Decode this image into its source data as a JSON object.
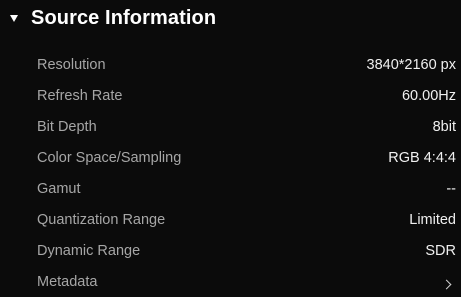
{
  "section": {
    "title": "Source Information",
    "expand_icon": "triangle-down-icon"
  },
  "rows": [
    {
      "label": "Resolution",
      "value": "3840*2160 px"
    },
    {
      "label": "Refresh Rate",
      "value": "60.00Hz"
    },
    {
      "label": "Bit Depth",
      "value": "8bit"
    },
    {
      "label": "Color Space/Sampling",
      "value": "RGB 4:4:4"
    },
    {
      "label": "Gamut",
      "value": "--"
    },
    {
      "label": "Quantization Range",
      "value": "Limited"
    },
    {
      "label": "Dynamic Range",
      "value": "SDR"
    },
    {
      "label": "Metadata",
      "icon": "chevron-right-icon"
    }
  ],
  "colors": {
    "background": "#0b0b0b",
    "title": "#ffffff",
    "label": "#a6a6a6",
    "value": "#f0f0f0"
  }
}
